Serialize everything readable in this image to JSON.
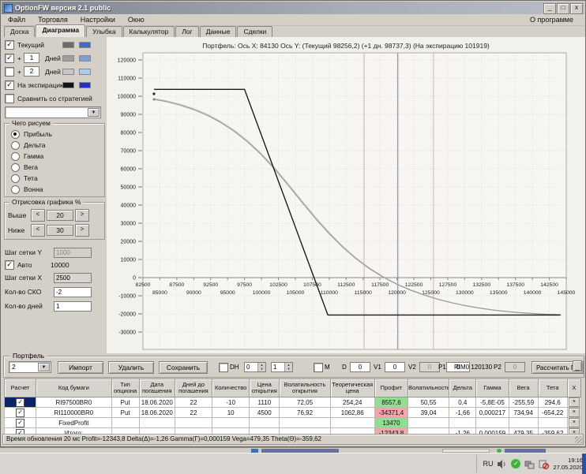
{
  "window": {
    "title": "OptionFW версия 2.1 public",
    "menu": [
      "Файл",
      "Торговля",
      "Настройки",
      "Окно"
    ],
    "menu_right": "О программе",
    "tabs": [
      "Доска",
      "Диаграмма",
      "Улыбка",
      "Калькулятор",
      "Лог",
      "Данные",
      "Сделки"
    ],
    "active_tab": "Диаграмма",
    "min_label": "_",
    "max_label": "□",
    "close_label": "x"
  },
  "left_panel": {
    "series_toggles": [
      {
        "label": "Текущий",
        "prefix": "",
        "days_input": null,
        "checked": true,
        "swatches": [
          "#6b6b6b",
          "#4169c8"
        ]
      },
      {
        "label": "Дней",
        "prefix": "+",
        "days_input": "1",
        "checked": true,
        "swatches": [
          "#9e9e9e",
          "#7d9fd4"
        ]
      },
      {
        "label": "Дней",
        "prefix": "+",
        "days_input": "2",
        "checked": false,
        "swatches": [
          "#c6c6c6",
          "#a9cdf0"
        ]
      },
      {
        "label": "На экспирацию",
        "prefix": "",
        "days_input": null,
        "checked": true,
        "swatches": [
          "#141414",
          "#2230c8"
        ]
      }
    ],
    "compare": {
      "label": "Сравнить со стратегией",
      "checked": false
    },
    "strategy_combo_value": "",
    "draw_group": {
      "title": "Чего рисуем",
      "options": [
        "Прибыль",
        "Дельта",
        "Гамма",
        "Вега",
        "Тета",
        "Вонна"
      ],
      "selected": "Прибыль"
    },
    "range_group": {
      "title": "Отрисовка графика %",
      "rows": [
        {
          "label": "Выше",
          "value": "20"
        },
        {
          "label": "Ниже",
          "value": "30"
        }
      ]
    },
    "grid_y": {
      "label": "Шаг сетки Y",
      "value": "1000"
    },
    "auto": {
      "label": "Авто",
      "checked": true,
      "value": "10000"
    },
    "grid_x": {
      "label": "Шаг сетки X",
      "value": "2500"
    },
    "sko": {
      "label": "Кол-во СКО",
      "value": "-2"
    },
    "days": {
      "label": "Кол-во дней",
      "value": "1"
    }
  },
  "chart": {
    "header": "Портфель:  Ось X: 84130  Ось Y:   (Текущий 98256,2)   (+1 дн. 98737,3)   (На экспирацию 101919)"
  },
  "chart_data": {
    "type": "line",
    "title": "Портфель",
    "xlim": [
      82500,
      145000
    ],
    "ylim": [
      -30000,
      120000
    ],
    "grid": "dotted",
    "x_ticks_row1": [
      82500,
      87500,
      92500,
      97500,
      102500,
      107500,
      112500,
      117500,
      122500,
      127500,
      132500,
      137500,
      142500
    ],
    "x_ticks_row2": [
      85000,
      90000,
      95000,
      100000,
      105000,
      110000,
      115000,
      120000,
      125000,
      130000,
      135000,
      140000,
      145000
    ],
    "y_ticks": [
      120000,
      110000,
      100000,
      90000,
      80000,
      70000,
      60000,
      50000,
      40000,
      30000,
      20000,
      10000,
      0,
      -10000,
      -20000,
      -30000
    ],
    "reference_lines": [
      {
        "x": 115175,
        "color": "#e2b6c2",
        "name": "sko-lower"
      },
      {
        "x": 120130,
        "color": "#8095aa",
        "name": "futures-price"
      },
      {
        "x": 125394,
        "color": "#e2b6c2",
        "name": "sko-upper"
      }
    ],
    "series": [
      {
        "name": "+1 день",
        "color": "#c4c4c4",
        "width": 1,
        "points": [
          [
            84130,
            98737
          ],
          [
            86000,
            97500
          ],
          [
            88000,
            95650
          ],
          [
            90000,
            93200
          ],
          [
            92000,
            90100
          ],
          [
            94000,
            86100
          ],
          [
            96000,
            81250
          ],
          [
            98000,
            75400
          ],
          [
            100000,
            68400
          ],
          [
            102000,
            60400
          ],
          [
            104000,
            51500
          ],
          [
            106000,
            42300
          ],
          [
            108000,
            33300
          ],
          [
            110000,
            24900
          ],
          [
            112000,
            17400
          ],
          [
            114000,
            10800
          ],
          [
            116000,
            5200
          ],
          [
            118000,
            500
          ],
          [
            120000,
            -3450
          ],
          [
            122000,
            -6700
          ],
          [
            124000,
            -9450
          ],
          [
            126000,
            -11800
          ],
          [
            128000,
            -13700
          ],
          [
            130000,
            -15350
          ],
          [
            132000,
            -16650
          ],
          [
            134000,
            -17780
          ],
          [
            136000,
            -18600
          ],
          [
            138000,
            -19300
          ],
          [
            140000,
            -19820
          ],
          [
            142000,
            -20220
          ],
          [
            144160,
            -20520
          ]
        ]
      },
      {
        "name": "Текущий",
        "color": "#999999",
        "width": 1.2,
        "points": [
          [
            84130,
            98256
          ],
          [
            86000,
            97000
          ],
          [
            88000,
            95100
          ],
          [
            90000,
            92600
          ],
          [
            92000,
            89500
          ],
          [
            94000,
            85500
          ],
          [
            96000,
            80600
          ],
          [
            98000,
            74700
          ],
          [
            100000,
            67700
          ],
          [
            102000,
            59600
          ],
          [
            104000,
            50700
          ],
          [
            106000,
            41500
          ],
          [
            108000,
            32500
          ],
          [
            110000,
            24200
          ],
          [
            112000,
            16800
          ],
          [
            114000,
            10300
          ],
          [
            116000,
            4800
          ],
          [
            118000,
            200
          ],
          [
            120000,
            -3700
          ],
          [
            122000,
            -6900
          ],
          [
            124000,
            -9600
          ],
          [
            126000,
            -11900
          ],
          [
            128000,
            -13800
          ],
          [
            130000,
            -15400
          ],
          [
            132000,
            -16700
          ],
          [
            134000,
            -17800
          ],
          [
            136000,
            -18600
          ],
          [
            138000,
            -19300
          ],
          [
            140000,
            -19800
          ],
          [
            142000,
            -20200
          ],
          [
            144160,
            -20500
          ]
        ]
      },
      {
        "name": "На экспирацию",
        "color": "#1c1c1c",
        "width": 1.4,
        "points": [
          [
            84130,
            103800
          ],
          [
            97500,
            103800
          ],
          [
            109800,
            -20600
          ],
          [
            144160,
            -20600
          ]
        ]
      }
    ],
    "markers": [
      {
        "x": 84130,
        "y": 101300,
        "color": "#222222",
        "name": "expiration-start"
      },
      {
        "x": 84130,
        "y": 98256,
        "color": "#8a8a8a",
        "name": "current-start"
      }
    ]
  },
  "portfolio_bar": {
    "group_label": "Портфель",
    "combo_value": "2",
    "buttons": [
      "Импорт",
      "Удалить",
      "Сохранить"
    ],
    "dh": {
      "label": "DH",
      "checked": false,
      "spin1": "0",
      "spin2": "1"
    },
    "m": {
      "label": "M",
      "checked": false
    },
    "fields": [
      {
        "label": "D",
        "value": "0",
        "disabled": false
      },
      {
        "label": "V1",
        "value": "0",
        "disabled": false
      },
      {
        "label": "V2",
        "value": "0",
        "disabled": true
      },
      {
        "label": "P1",
        "value": "0",
        "disabled": false
      }
    ],
    "instrument": "RIM0 120130",
    "p2": {
      "label": "P2",
      "value": "0",
      "disabled": true
    },
    "calc_button": "Рассчитать ГО",
    "collapse_button": "_"
  },
  "table": {
    "columns": [
      "Расчет",
      "Код бумаги",
      "Тип опциона",
      "Дата погашения",
      "Дней до погашения",
      "Количество",
      "Цена открытия",
      "Волатильность открытия",
      "Теоретическая цена",
      "Профит",
      "Волатильность",
      "Дельта",
      "Гамма",
      "Вега",
      "Тета",
      "X"
    ],
    "delete_label": "×",
    "rows": [
      {
        "calc": true,
        "selected": true,
        "code": "RI97500BR0",
        "type": "Put",
        "expiry": "18.06.2020",
        "days": "22",
        "qty": "-10",
        "open_price": "1110",
        "open_vol": "72,05",
        "theor_price": "254,24",
        "profit": "8557,6",
        "profit_state": "pos",
        "vol": "50,55",
        "delta": "0,4",
        "gamma": "-5,8E-05",
        "vega": "-255,59",
        "theta": "294,6"
      },
      {
        "calc": true,
        "selected": false,
        "code": "RI110000BR0",
        "type": "Put",
        "expiry": "18.06.2020",
        "days": "22",
        "qty": "10",
        "open_price": "4500",
        "open_vol": "76,92",
        "theor_price": "1062,86",
        "profit": "-34371,4",
        "profit_state": "neg",
        "vol": "39,04",
        "delta": "-1,66",
        "gamma": "0,000217",
        "vega": "734,94",
        "theta": "-654,22"
      },
      {
        "calc": true,
        "selected": false,
        "code": "FixedProfit",
        "type": "",
        "expiry": "",
        "days": "",
        "qty": "",
        "open_price": "",
        "open_vol": "",
        "theor_price": "",
        "profit": "13470",
        "profit_state": "pos",
        "vol": "",
        "delta": "",
        "gamma": "",
        "vega": "",
        "theta": ""
      },
      {
        "calc": true,
        "selected": false,
        "code": "Итого:",
        "type": "",
        "expiry": "",
        "days": "",
        "qty": "",
        "open_price": "",
        "open_vol": "",
        "theor_price": "",
        "profit": "-12343,8",
        "profit_state": "neg",
        "vol": "",
        "delta": "-1,26",
        "gamma": "0,000159",
        "vega": "479,35",
        "theta": "-359,62"
      }
    ]
  },
  "status_bar": {
    "text": "Время обновления 20 мс   Profit=-12343,8 Delta(Δ)=-1,26 Gamma(Γ)=0,000159 Vega=479,35 Theta(Θ)=-359,62"
  },
  "taskbar": {
    "language": "RU",
    "time": "19:16",
    "date": "27.05.2020"
  }
}
